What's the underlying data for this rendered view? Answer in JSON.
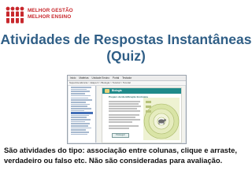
{
  "logo": {
    "line1": "MELHOR GESTÃO",
    "line2": "MELHOR ENSINO",
    "brand_color": "#c8282d"
  },
  "title": {
    "line1": "Atividades de Respostas Instantâneas",
    "line2": "(Quiz)",
    "color": "#2f5e86"
  },
  "screenshot": {
    "menubar": [
      "Inicio",
      "Matérias",
      "Unidade Ensino",
      "Portal",
      "Testador"
    ],
    "breadcrumb": "Superintendência > Etapa 3 > Biologia > Tutorial > Tutorial",
    "section_title": "Biologia",
    "subtitle": "Preparo da Identificação Ecológica",
    "button_label": "Prosseguir",
    "header_color": "#1f8a8a"
  },
  "description": "São atividades do tipo: associação entre colunas, clique e arraste, verdadeiro ou falso etc. Não são consideradas para avaliação."
}
